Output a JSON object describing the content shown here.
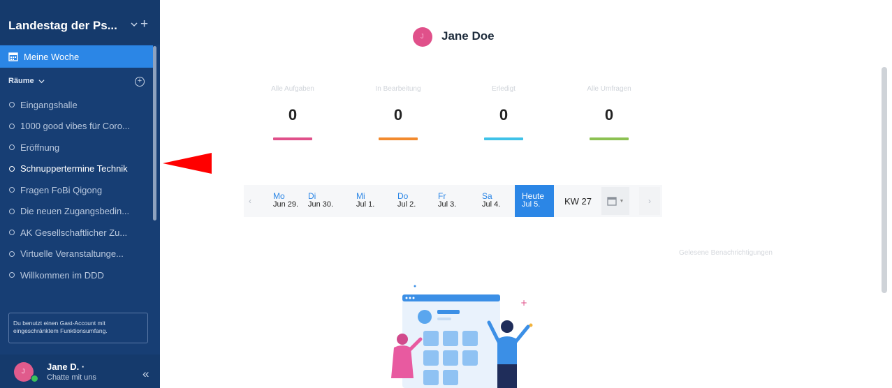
{
  "sidebar": {
    "workspace_title": "Landestag der Ps...",
    "plus_symbol": "+",
    "meine_woche": "Meine Woche",
    "raeume_label": "Räume",
    "add_room_symbol": "+",
    "rooms": [
      "Eingangshalle",
      "1000 good vibes für Coro...",
      "Eröffnung",
      "Schnuppertermine Technik",
      "Fragen FoBi Qigong",
      "Die neuen Zugangsbedin...",
      "AK Gesellschaftlicher Zu...",
      "Virtuelle Veranstaltunge...",
      "Willkommen im DDD"
    ],
    "guest_notice": "Du benutzt einen Gast-Account mit eingeschränktem Funktionsumfang.",
    "user": {
      "initial": "J",
      "name": "Jane D. ·",
      "subtitle": "Chatte mit uns"
    },
    "collapse_symbol": "«"
  },
  "main": {
    "user_initial": "J",
    "user_name": "Jane Doe",
    "stats": [
      {
        "label": "Alle Aufgaben",
        "value": "0",
        "color": "#e0508a"
      },
      {
        "label": "In Bearbeitung",
        "value": "0",
        "color": "#f28a2e"
      },
      {
        "label": "Erledigt",
        "value": "0",
        "color": "#3fc2e8"
      },
      {
        "label": "Alle Umfragen",
        "value": "0",
        "color": "#8cc152"
      }
    ],
    "datebar": {
      "prev": "‹",
      "days": [
        {
          "name": "Mo",
          "date": "Jun 29."
        },
        {
          "name": "Di",
          "date": "Jun 30."
        },
        {
          "name": "Mi",
          "date": "Jul 1."
        },
        {
          "name": "Do",
          "date": "Jul 2."
        },
        {
          "name": "Fr",
          "date": "Jul 3."
        },
        {
          "name": "Sa",
          "date": "Jul 4."
        }
      ],
      "today": {
        "name": "Heute",
        "date": "Jul 5."
      },
      "week": "KW 27",
      "next": "›"
    },
    "notifications": "Gelesene Benachrichtigungen"
  },
  "colors": {
    "sidebar_bg": "#173e74",
    "accent": "#2b86e6",
    "annotation_arrow": "#ff0000"
  }
}
